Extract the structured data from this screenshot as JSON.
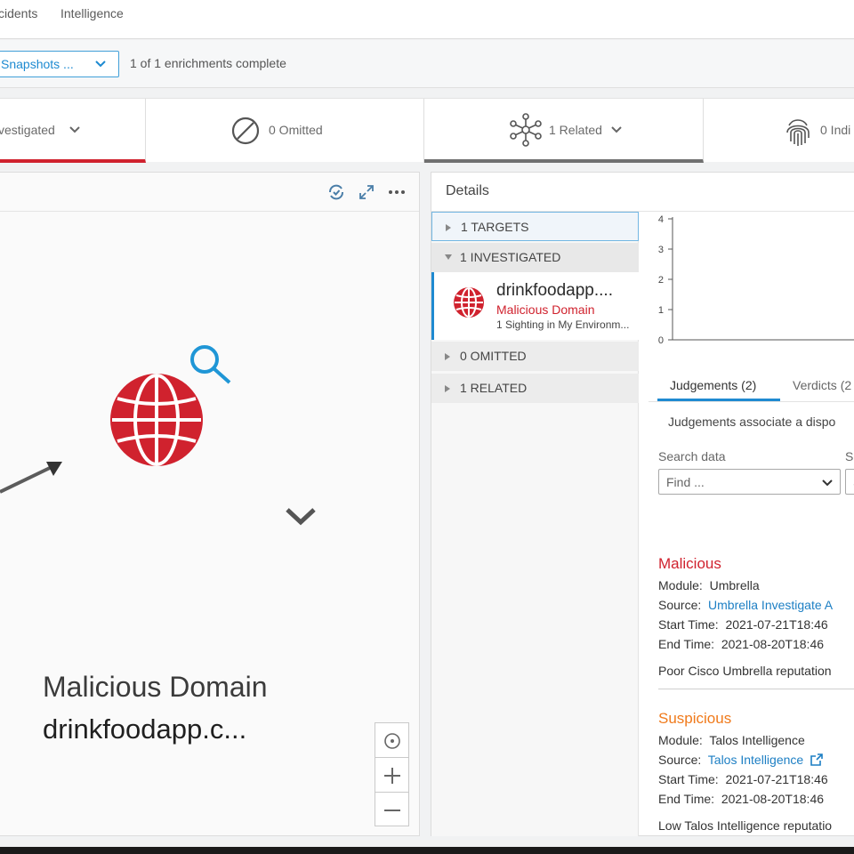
{
  "nav": {
    "items": [
      "cidents",
      "Intelligence"
    ]
  },
  "toolbar": {
    "snapshots_label": "Snapshots ...",
    "enrichment_status": "1 of 1 enrichments complete"
  },
  "tabs": {
    "investigated": "vestigated",
    "omitted": "0 Omitted",
    "related": "1 Related",
    "indicators": "0 Indi"
  },
  "graph": {
    "node_type": "Malicious Domain",
    "node_name": "drinkfoodapp.c..."
  },
  "details": {
    "title": "Details",
    "tree": {
      "targets": "1 TARGETS",
      "investigated": "1 INVESTIGATED",
      "omitted": "0 OMITTED",
      "related": "1 RELATED"
    },
    "observable": {
      "name": "drinkfoodapp....",
      "type": "Malicious Domain",
      "sightings": "1 Sighting in My Environm..."
    },
    "chart_data": {
      "type": "bar",
      "y_ticks": [
        "4",
        "3",
        "2",
        "1",
        "0"
      ],
      "ylim": [
        0,
        4
      ]
    },
    "subtabs": {
      "judgements": "Judgements (2)",
      "verdicts": "Verdicts (2"
    },
    "description": "Judgements associate a dispo",
    "search": {
      "label": "Search data",
      "label2": "S",
      "placeholder": "Find ...",
      "select_stub": "S"
    },
    "judgements": [
      {
        "verdict": "Malicious",
        "module_label": "Module:",
        "module": "Umbrella",
        "source_label": "Source:",
        "source": "Umbrella Investigate A",
        "start_label": "Start Time:",
        "start": "2021-07-21T18:46",
        "end_label": "End Time:",
        "end": "2021-08-20T18:46",
        "note": "Poor Cisco Umbrella reputation"
      },
      {
        "verdict": "Suspicious",
        "module_label": "Module:",
        "module": "Talos Intelligence",
        "source_label": "Source:",
        "source": "Talos Intelligence",
        "start_label": "Start Time:",
        "start": "2021-07-21T18:46",
        "end_label": "End Time:",
        "end": "2021-08-20T18:46",
        "note": "Low Talos Intelligence reputatio"
      }
    ]
  },
  "colors": {
    "malicious": "#d0222e",
    "suspicious": "#f07a1b",
    "accent": "#1f8ad1"
  }
}
